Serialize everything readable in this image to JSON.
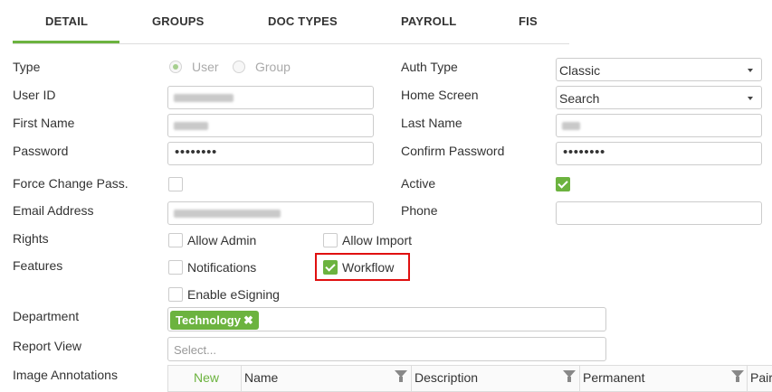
{
  "tabs": [
    {
      "label": "DETAIL",
      "active": true
    },
    {
      "label": "GROUPS"
    },
    {
      "label": "DOC TYPES"
    },
    {
      "label": "PAYROLL"
    },
    {
      "label": "FIS"
    }
  ],
  "accent_color": "#6cb33f",
  "form": {
    "type_label": "Type",
    "type_options": [
      "User",
      "Group"
    ],
    "type_selected": "User",
    "auth_type_label": "Auth Type",
    "auth_type_value": "Classic",
    "user_id_label": "User ID",
    "home_screen_label": "Home Screen",
    "home_screen_value": "Search",
    "first_name_label": "First Name",
    "last_name_label": "Last Name",
    "password_label": "Password",
    "password_value": "••••••••",
    "confirm_password_label": "Confirm Password",
    "confirm_password_value": "••••••••",
    "force_change_label": "Force Change Pass.",
    "force_change_checked": false,
    "active_label": "Active",
    "active_checked": true,
    "email_label": "Email Address",
    "phone_label": "Phone",
    "rights_label": "Rights",
    "allow_admin_label": "Allow Admin",
    "allow_admin_checked": false,
    "allow_import_label": "Allow Import",
    "allow_import_checked": false,
    "features_label": "Features",
    "notifications_label": "Notifications",
    "notifications_checked": false,
    "workflow_label": "Workflow",
    "workflow_checked": true,
    "esigning_label": "Enable eSigning",
    "esigning_checked": false,
    "department_label": "Department",
    "department_tag": "Technology",
    "report_view_label": "Report View",
    "report_view_placeholder": "Select...",
    "image_annotations_label": "Image Annotations"
  },
  "annotations_grid": {
    "new_label": "New",
    "columns": [
      "Name",
      "Description",
      "Permanent",
      "Pair"
    ]
  }
}
